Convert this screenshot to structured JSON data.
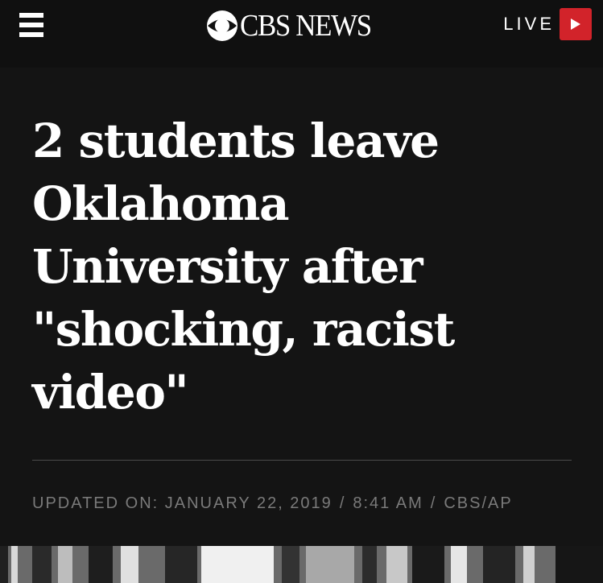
{
  "header": {
    "menu_icon": "hamburger-menu-icon",
    "logo_text": "CBS NEWS",
    "logo_icon": "cbs-eye-icon",
    "live_label": "LIVE",
    "live_icon": "play-icon",
    "live_color": "#d2232a"
  },
  "article": {
    "headline_lines": [
      "2 students leave",
      "Oklahoma",
      "University after",
      "\"shocking, racist",
      "video\""
    ],
    "meta": {
      "updated_label": "UPDATED ON:",
      "date": "JANUARY 22, 2019",
      "time": "8:41 AM",
      "source": "CBS/AP",
      "separator": "/"
    }
  },
  "colors": {
    "background": "#141414",
    "text": "#ffffff",
    "meta_text": "#7a7a7a"
  }
}
